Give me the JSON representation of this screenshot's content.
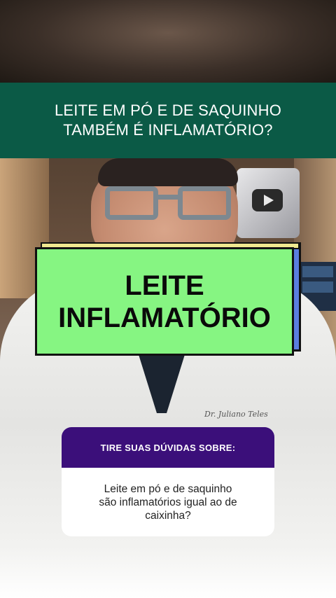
{
  "title_banner": {
    "line1": "LEITE EM PÓ E DE SAQUINHO",
    "line2": "TAMBÉM É INFLAMATÓRIO?",
    "background": "#0b5a46"
  },
  "callout": {
    "line1": "LEITE",
    "line2": "INFLAMATÓRIO",
    "background": "#86f582",
    "accent": "#5a7ee0"
  },
  "coat_embroidery": "Dr. Juliano Teles",
  "question_card": {
    "header": "TIRE SUAS DÚVIDAS SOBRE:",
    "line1": "Leite em pó e de saquinho",
    "line2": "são inflamatórios igual ao de",
    "line3": "caixinha?",
    "header_color": "#3b0f7a"
  },
  "icons": {
    "play_plaque": "youtube-play-icon"
  }
}
